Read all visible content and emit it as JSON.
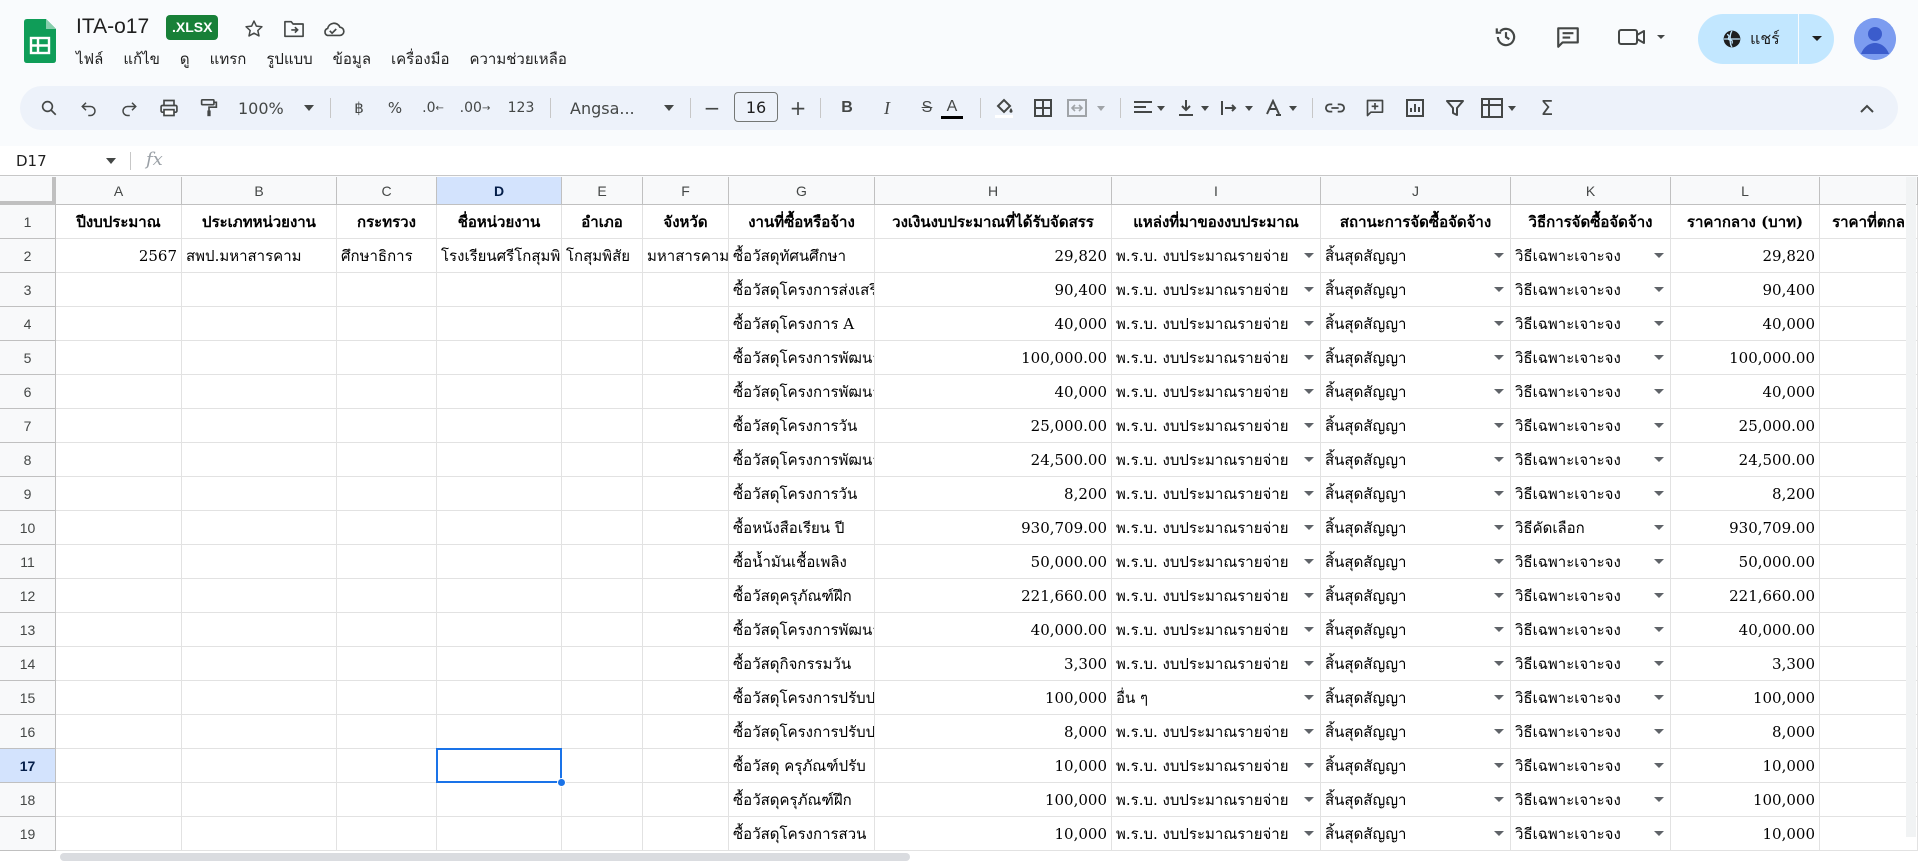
{
  "header": {
    "title": "ITA-o17",
    "badge": ".XLSX",
    "menu": [
      "ไฟล์",
      "แก้ไข",
      "ดู",
      "แทรก",
      "รูปแบบ",
      "ข้อมูล",
      "เครื่องมือ",
      "ความช่วยเหลือ"
    ],
    "share_label": "แชร์"
  },
  "toolbar": {
    "zoom": "100%",
    "currency": "฿",
    "percent": "%",
    "dec_decrease": ".0",
    "dec_increase": ".00",
    "format_123": "123",
    "font": "Angsa...",
    "font_size": "16"
  },
  "formula_bar": {
    "cell_ref": "D17",
    "fx": "fx",
    "value": ""
  },
  "grid": {
    "columns": [
      "A",
      "B",
      "C",
      "D",
      "E",
      "F",
      "G",
      "H",
      "I",
      "J",
      "K",
      "L"
    ],
    "selected_column": "D",
    "rows": [
      "1",
      "2",
      "3",
      "4",
      "5",
      "6",
      "7",
      "8",
      "9",
      "10",
      "11",
      "12",
      "13",
      "14",
      "15",
      "16",
      "17",
      "18",
      "19"
    ],
    "selected_row": "17",
    "headers": [
      "ปีงบประมาณ",
      "ประเภทหน่วยงาน",
      "กระทรวง",
      "ชื่อหน่วยงาน",
      "อำเภอ",
      "จังหวัด",
      "งานที่ซื้อหรือจ้าง",
      "วงเงินงบประมาณที่ได้รับจัดสรร",
      "แหล่งที่มาของงบประมาณ",
      "สถานะการจัดซื้อจัดจ้าง",
      "วิธีการจัดซื้อจัดจ้าง",
      "ราคากลาง (บาท)",
      "ราคาที่ตกล"
    ],
    "row2": {
      "year": "2567",
      "agency_type": "สพป.มหาสารคาม",
      "ministry": "ศึกษาธิการ",
      "agency": "โรงเรียนศรีโกสุมพิสัย",
      "district": "โกสุมพิสัย",
      "province": "มหาสารคาม"
    },
    "data": [
      {
        "task": "ซื้อวัสดุทัศนศึกษา",
        "budget": "29,820",
        "source": "พ.ร.บ. งบประมาณรายจ่าย",
        "status": "สิ้นสุดสัญญา",
        "method": "วิธีเฉพาะเจาะจง",
        "price": "29,820"
      },
      {
        "task": "ซื้อวัสดุโครงการส่งเสริม",
        "budget": "90,400",
        "source": "พ.ร.บ. งบประมาณรายจ่าย",
        "status": "สิ้นสุดสัญญา",
        "method": "วิธีเฉพาะเจาะจง",
        "price": "90,400"
      },
      {
        "task": "ซื้อวัสดุโครงการ A",
        "budget": "40,000",
        "source": "พ.ร.บ. งบประมาณรายจ่าย",
        "status": "สิ้นสุดสัญญา",
        "method": "วิธีเฉพาะเจาะจง",
        "price": "40,000"
      },
      {
        "task": "ซื้อวัสดุโครงการพัฒนา",
        "budget": "100,000.00",
        "source": "พ.ร.บ. งบประมาณรายจ่าย",
        "status": "สิ้นสุดสัญญา",
        "method": "วิธีเฉพาะเจาะจง",
        "price": "100,000.00"
      },
      {
        "task": "ซื้อวัสดุโครงการพัฒนา",
        "budget": "40,000",
        "source": "พ.ร.บ. งบประมาณรายจ่าย",
        "status": "สิ้นสุดสัญญา",
        "method": "วิธีเฉพาะเจาะจง",
        "price": "40,000"
      },
      {
        "task": "ซื้อวัสดุโครงการวัน",
        "budget": "25,000.00",
        "source": "พ.ร.บ. งบประมาณรายจ่าย",
        "status": "สิ้นสุดสัญญา",
        "method": "วิธีเฉพาะเจาะจง",
        "price": "25,000.00"
      },
      {
        "task": "ซื้อวัสดุโครงการพัฒนา",
        "budget": "24,500.00",
        "source": "พ.ร.บ. งบประมาณรายจ่าย",
        "status": "สิ้นสุดสัญญา",
        "method": "วิธีเฉพาะเจาะจง",
        "price": "24,500.00"
      },
      {
        "task": "ซื้อวัสดุโครงการวัน",
        "budget": "8,200",
        "source": "พ.ร.บ. งบประมาณรายจ่าย",
        "status": "สิ้นสุดสัญญา",
        "method": "วิธีเฉพาะเจาะจง",
        "price": "8,200"
      },
      {
        "task": "ซื้อหนังสือเรียน ปี",
        "budget": "930,709.00",
        "source": "พ.ร.บ. งบประมาณรายจ่าย",
        "status": "สิ้นสุดสัญญา",
        "method": "วิธีคัดเลือก",
        "price": "930,709.00"
      },
      {
        "task": "ซื้อน้ำมันเชื้อเพลิง",
        "budget": "50,000.00",
        "source": "พ.ร.บ. งบประมาณรายจ่าย",
        "status": "สิ้นสุดสัญญา",
        "method": "วิธีเฉพาะเจาะจง",
        "price": "50,000.00"
      },
      {
        "task": "ซื้อวัสดุครุภัณฑ์ฝึก",
        "budget": "221,660.00",
        "source": "พ.ร.บ. งบประมาณรายจ่าย",
        "status": "สิ้นสุดสัญญา",
        "method": "วิธีเฉพาะเจาะจง",
        "price": "221,660.00"
      },
      {
        "task": "ซื้อวัสดุโครงการพัฒนา",
        "budget": "40,000.00",
        "source": "พ.ร.บ. งบประมาณรายจ่าย",
        "status": "สิ้นสุดสัญญา",
        "method": "วิธีเฉพาะเจาะจง",
        "price": "40,000.00"
      },
      {
        "task": "ซื้อวัสดุกิจกรรมวัน",
        "budget": "3,300",
        "source": "พ.ร.บ. งบประมาณรายจ่าย",
        "status": "สิ้นสุดสัญญา",
        "method": "วิธีเฉพาะเจาะจง",
        "price": "3,300"
      },
      {
        "task": "ซื้อวัสดุโครงการปรับปรุง",
        "budget": "100,000",
        "source": "อื่น ๆ",
        "status": "สิ้นสุดสัญญา",
        "method": "วิธีเฉพาะเจาะจง",
        "price": "100,000"
      },
      {
        "task": "ซื้อวัสดุโครงการปรับปรุง",
        "budget": "8,000",
        "source": "พ.ร.บ. งบประมาณรายจ่าย",
        "status": "สิ้นสุดสัญญา",
        "method": "วิธีเฉพาะเจาะจง",
        "price": "8,000"
      },
      {
        "task": "ซื้อวัสดุ ครุภัณฑ์ปรับ",
        "budget": "10,000",
        "source": "พ.ร.บ. งบประมาณรายจ่าย",
        "status": "สิ้นสุดสัญญา",
        "method": "วิธีเฉพาะเจาะจง",
        "price": "10,000"
      },
      {
        "task": "ซื้อวัสดุครุภัณฑ์ฝึก",
        "budget": "100,000",
        "source": "พ.ร.บ. งบประมาณรายจ่าย",
        "status": "สิ้นสุดสัญญา",
        "method": "วิธีเฉพาะเจาะจง",
        "price": "100,000"
      },
      {
        "task": "ซื้อวัสดุโครงการสวน",
        "budget": "10,000",
        "source": "พ.ร.บ. งบประมาณรายจ่าย",
        "status": "สิ้นสุดสัญญา",
        "method": "วิธีเฉพาะเจาะจง",
        "price": "10,000"
      }
    ]
  }
}
